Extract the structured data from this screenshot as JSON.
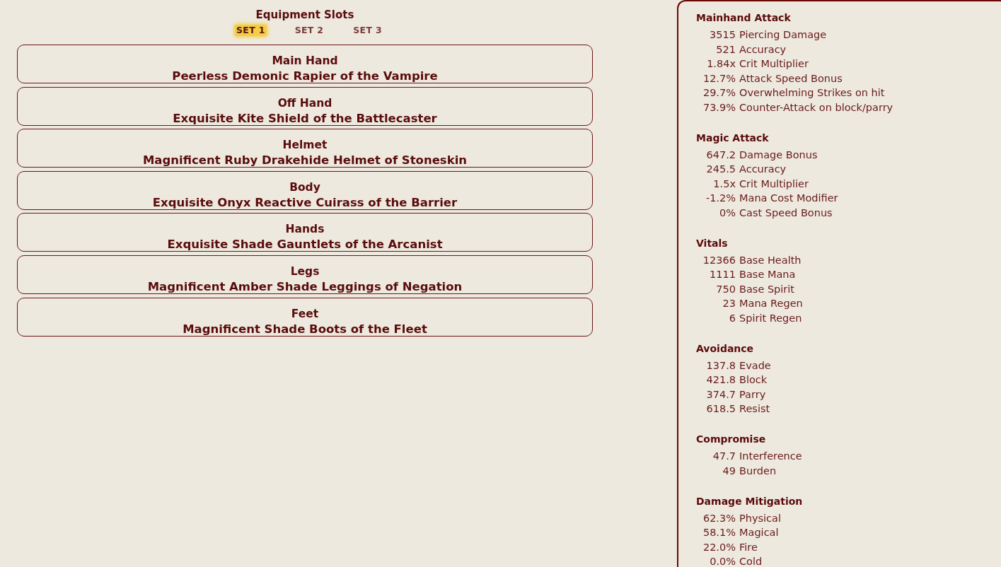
{
  "equipment": {
    "title": "Equipment Slots",
    "sets": [
      {
        "label": "SET 1",
        "selected": true
      },
      {
        "label": "SET 2",
        "selected": false
      },
      {
        "label": "SET 3",
        "selected": false
      }
    ],
    "slots": [
      {
        "slot": "Main Hand",
        "item": "Peerless Demonic Rapier of the Vampire"
      },
      {
        "slot": "Off Hand",
        "item": "Exquisite Kite Shield of the Battlecaster"
      },
      {
        "slot": "Helmet",
        "item": "Magnificent Ruby Drakehide Helmet of Stoneskin"
      },
      {
        "slot": "Body",
        "item": "Exquisite Onyx Reactive Cuirass of the Barrier"
      },
      {
        "slot": "Hands",
        "item": "Exquisite Shade Gauntlets of the Arcanist"
      },
      {
        "slot": "Legs",
        "item": "Magnificent Amber Shade Leggings of Negation"
      },
      {
        "slot": "Feet",
        "item": "Magnificent Shade Boots of the Fleet"
      }
    ]
  },
  "stats": {
    "sections": [
      {
        "title": "Mainhand Attack",
        "rows": [
          {
            "amount": "3515",
            "stat": "Piercing Damage"
          },
          {
            "amount": "521",
            "stat": "Accuracy"
          },
          {
            "amount": "1.84x",
            "stat": "Crit Multiplier"
          },
          {
            "amount": "12.7%",
            "stat": "Attack Speed Bonus"
          },
          {
            "amount": "29.7%",
            "stat": "Overwhelming Strikes on hit"
          },
          {
            "amount": "73.9%",
            "stat": "Counter-Attack on block/parry"
          }
        ]
      },
      {
        "title": "Magic Attack",
        "rows": [
          {
            "amount": "647.2",
            "stat": "Damage Bonus"
          },
          {
            "amount": "245.5",
            "stat": "Accuracy"
          },
          {
            "amount": "1.5x",
            "stat": "Crit Multiplier"
          },
          {
            "amount": "-1.2%",
            "stat": "Mana Cost Modifier"
          },
          {
            "amount": "0%",
            "stat": "Cast Speed Bonus"
          }
        ]
      },
      {
        "title": "Vitals",
        "rows": [
          {
            "amount": "12366",
            "stat": "Base Health"
          },
          {
            "amount": "1111",
            "stat": "Base Mana"
          },
          {
            "amount": "750",
            "stat": "Base Spirit"
          },
          {
            "amount": "23",
            "stat": "Mana Regen"
          },
          {
            "amount": "6",
            "stat": "Spirit Regen"
          }
        ]
      },
      {
        "title": "Avoidance",
        "rows": [
          {
            "amount": "137.8",
            "stat": "Evade"
          },
          {
            "amount": "421.8",
            "stat": "Block"
          },
          {
            "amount": "374.7",
            "stat": "Parry"
          },
          {
            "amount": "618.5",
            "stat": "Resist"
          }
        ]
      },
      {
        "title": "Compromise",
        "rows": [
          {
            "amount": "47.7",
            "stat": "Interference"
          },
          {
            "amount": "49",
            "stat": "Burden"
          }
        ]
      },
      {
        "title": "Damage Mitigation",
        "rows": [
          {
            "amount": "62.3%",
            "stat": "Physical"
          },
          {
            "amount": "58.1%",
            "stat": "Magical"
          },
          {
            "amount": "22.0%",
            "stat": "Fire"
          },
          {
            "amount": "0.0%",
            "stat": "Cold"
          }
        ]
      }
    ]
  }
}
